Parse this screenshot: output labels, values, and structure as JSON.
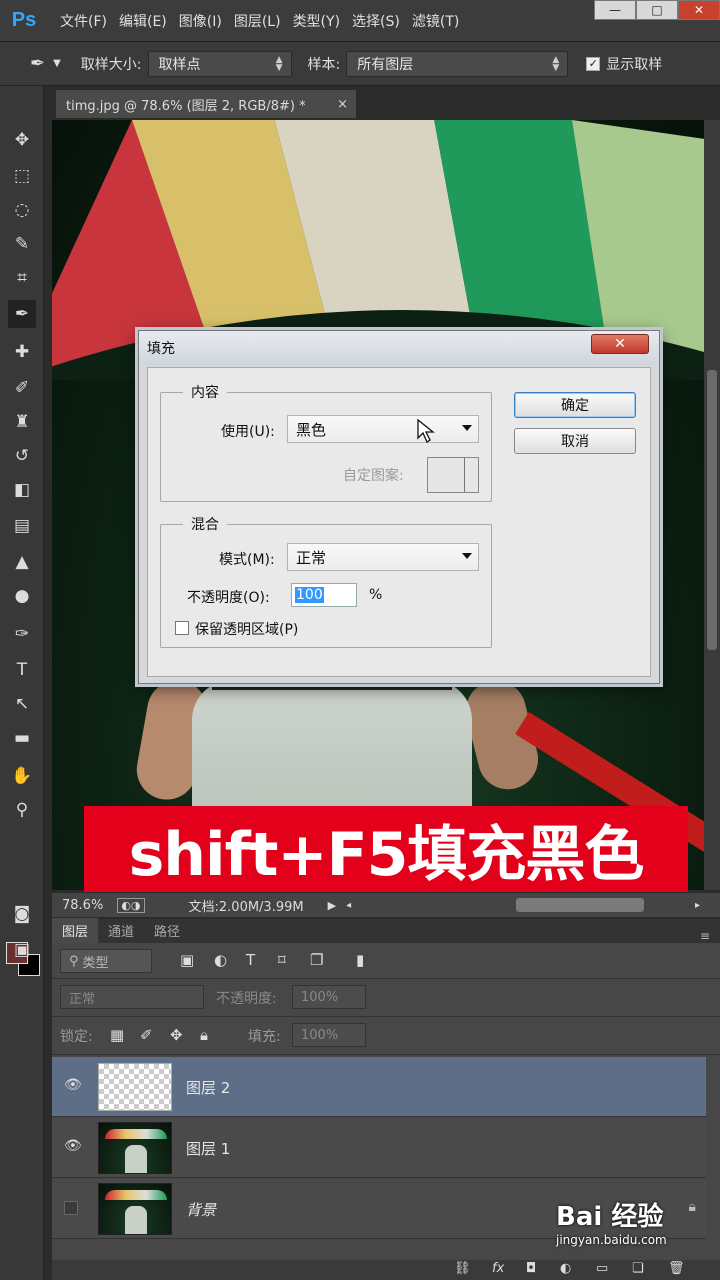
{
  "app": {
    "logo": "Ps"
  },
  "menu": [
    "文件(F)",
    "编辑(E)",
    "图像(I)",
    "图层(L)",
    "类型(Y)",
    "选择(S)",
    "滤镜(T)"
  ],
  "window_controls": {
    "minimize": "—",
    "maximize": "□",
    "close": "✕"
  },
  "options": {
    "sample_size_label": "取样大小:",
    "sample_size_value": "取样点",
    "sample_label": "样本:",
    "sample_value": "所有图层",
    "show_ring_label": "显示取样"
  },
  "document": {
    "tab_title": "timg.jpg @ 78.6% (图层 2, RGB/8#) *",
    "tab_close": "×",
    "zoom": "78.6%",
    "doc_size": "文档:2.00M/3.99M"
  },
  "banner": {
    "text": "shift+F5填充黑色"
  },
  "dialog": {
    "title": "填充",
    "close": "✕",
    "content_group": "内容",
    "use_label": "使用(U):",
    "use_value": "黑色",
    "custom_pattern_label": "自定图案:",
    "blend_group": "混合",
    "mode_label": "模式(M):",
    "mode_value": "正常",
    "opacity_label": "不透明度(O):",
    "opacity_value": "100",
    "opacity_unit": "%",
    "preserve_label": "保留透明区域(P)",
    "ok": "确定",
    "cancel": "取消"
  },
  "layers_panel": {
    "tabs": [
      "图层",
      "通道",
      "路径"
    ],
    "filter_value": "类型",
    "blend_mode": "正常",
    "opacity_label": "不透明度:",
    "opacity_value": "100%",
    "lock_label": "锁定:",
    "fill_label": "填充:",
    "fill_value": "100%",
    "layers": [
      {
        "name": "图层 2",
        "visible": true,
        "selected": true
      },
      {
        "name": "图层 1",
        "visible": true,
        "selected": false
      },
      {
        "name": "背景",
        "visible": false,
        "selected": false,
        "locked": true
      }
    ]
  },
  "watermark": {
    "brand": "Bai 经验",
    "url": "jingyan.baidu.com"
  }
}
